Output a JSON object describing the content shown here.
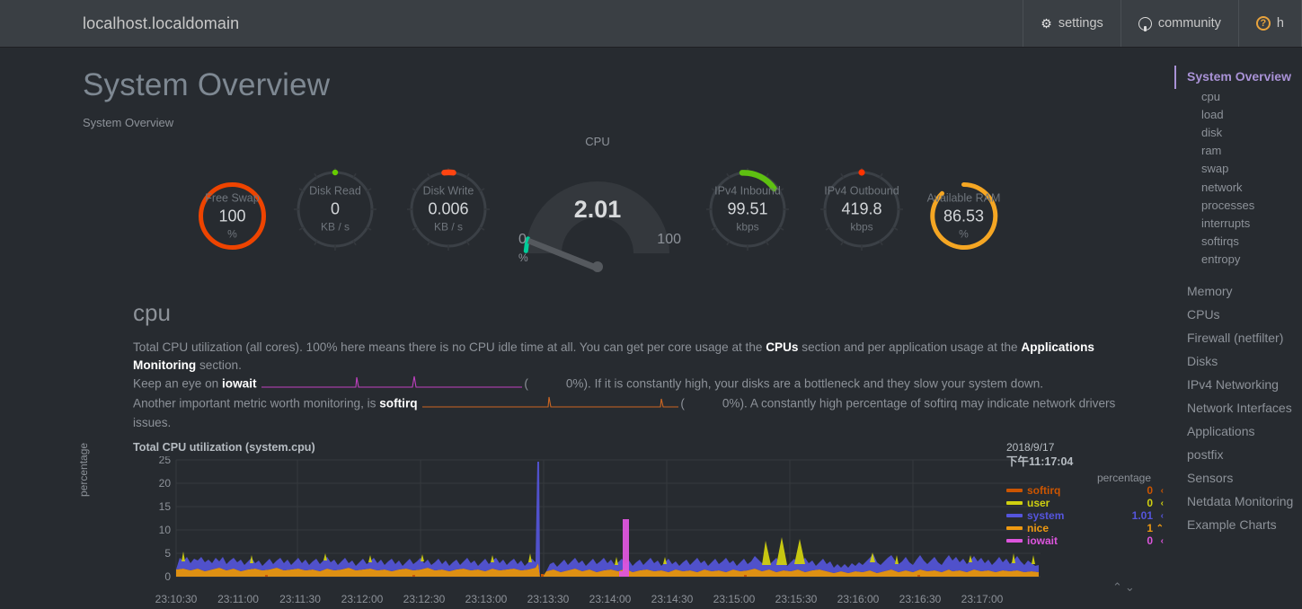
{
  "navbar": {
    "brand": "localhost.localdomain",
    "items": [
      {
        "label": "settings",
        "icon": "gear-icon"
      },
      {
        "label": "community",
        "icon": "github-icon"
      },
      {
        "label": "h",
        "icon": "help-circle-icon"
      }
    ]
  },
  "page": {
    "title": "System Overview",
    "subtitle": "System Overview"
  },
  "gauges": [
    {
      "name": "free-swap",
      "label": "Free Swap",
      "value": "100",
      "units": "%",
      "type": "ring",
      "color": "#ee4400",
      "percent": 100
    },
    {
      "name": "disk-read",
      "label": "Disk Read",
      "value": "0",
      "units": "KB / s",
      "type": "ring",
      "color": "#66cc00",
      "percent": 1
    },
    {
      "name": "disk-write",
      "label": "Disk Write",
      "value": "0.006",
      "units": "KB / s",
      "type": "ring",
      "color": "#ff4411",
      "percent": 2
    },
    {
      "name": "ipv4-inbound",
      "label": "IPv4 Inbound",
      "value": "99.51",
      "units": "kbps",
      "type": "ring",
      "color": "#5ec011",
      "percent": 14
    },
    {
      "name": "ipv4-outbound",
      "label": "IPv4 Outbound",
      "value": "419.8",
      "units": "kbps",
      "type": "ring",
      "color": "#ff3300",
      "percent": 1.5
    },
    {
      "name": "available-ram",
      "label": "Available RAM",
      "value": "86.53",
      "units": "%",
      "type": "ring",
      "color": "#f5a623",
      "percent": 86.53
    }
  ],
  "cpu_gauge": {
    "title": "CPU",
    "value": "2.01",
    "min": "0",
    "max": "100",
    "units": "%",
    "needle_percent": 2.01,
    "arc_color": "#00cc99"
  },
  "section": {
    "heading": "cpu",
    "p1_a": "Total CPU utilization (all cores). 100% here means there is no CPU idle time at all. You can get per core usage at the ",
    "p1_link1": "CPUs",
    "p1_b": " section and per application usage at the ",
    "p1_link2": "Applications Monitoring",
    "p1_c": " section.",
    "p2_a": "Keep an eye on ",
    "p2_metric": "iowait",
    "p2_paren_open": "(",
    "p2_value": "0%",
    "p2_b": "). If it is constantly high, your disks are a bottleneck and they slow your system down.",
    "p3_a": "Another important metric worth monitoring, is ",
    "p3_metric": "softirq",
    "p3_paren_open": "(",
    "p3_value": "0%",
    "p3_b": "). A constantly high percentage of softirq may indicate network drivers issues.",
    "iowait_spark_color": "#c040c0",
    "softirq_spark_color": "#cc6622"
  },
  "chart_data": {
    "type": "area",
    "title": "Total CPU utilization (system.cpu)",
    "ylabel": "percentage",
    "xlabel": "",
    "ylim": [
      0,
      27
    ],
    "yticks": [
      0,
      5,
      10,
      15,
      20,
      25
    ],
    "grid": true,
    "legend_position": "right",
    "stacked": true,
    "xticks": [
      "23:10:30",
      "23:11:00",
      "23:11:30",
      "23:12:00",
      "23:12:30",
      "23:13:00",
      "23:13:30",
      "23:14:00",
      "23:14:30",
      "23:15:00",
      "23:15:30",
      "23:16:00",
      "23:16:30",
      "23:17:00"
    ],
    "xlim": [
      "23:10:10",
      "23:17:08"
    ],
    "series": [
      {
        "name": "softirq",
        "color": "#cc5500",
        "value": "0",
        "arrow": "‹"
      },
      {
        "name": "user",
        "color": "#d0d010",
        "value": "0",
        "arrow": "‹"
      },
      {
        "name": "system",
        "color": "#5555dd",
        "value": "1.01",
        "arrow": "‹"
      },
      {
        "name": "nice",
        "color": "#ee9911",
        "value": "1",
        "arrow": "⌃"
      },
      {
        "name": "iowait",
        "color": "#dd55dd",
        "value": "0",
        "arrow": "‹"
      }
    ],
    "hover": {
      "date": "2018/9/17",
      "time": "下午11:17:04",
      "units": "percentage"
    }
  },
  "sidebar": {
    "active": "System Overview",
    "sub_items": [
      "cpu",
      "load",
      "disk",
      "ram",
      "swap",
      "network",
      "processes",
      "interrupts",
      "softirqs",
      "entropy"
    ],
    "main_items": [
      "Memory",
      "CPUs",
      "Firewall (netfilter)",
      "Disks",
      "IPv4 Networking",
      "Network Interfaces",
      "Applications",
      "postfix",
      "Sensors",
      "Netdata Monitoring",
      "Example Charts"
    ]
  },
  "controls": {
    "resize": "⌃⌄"
  }
}
